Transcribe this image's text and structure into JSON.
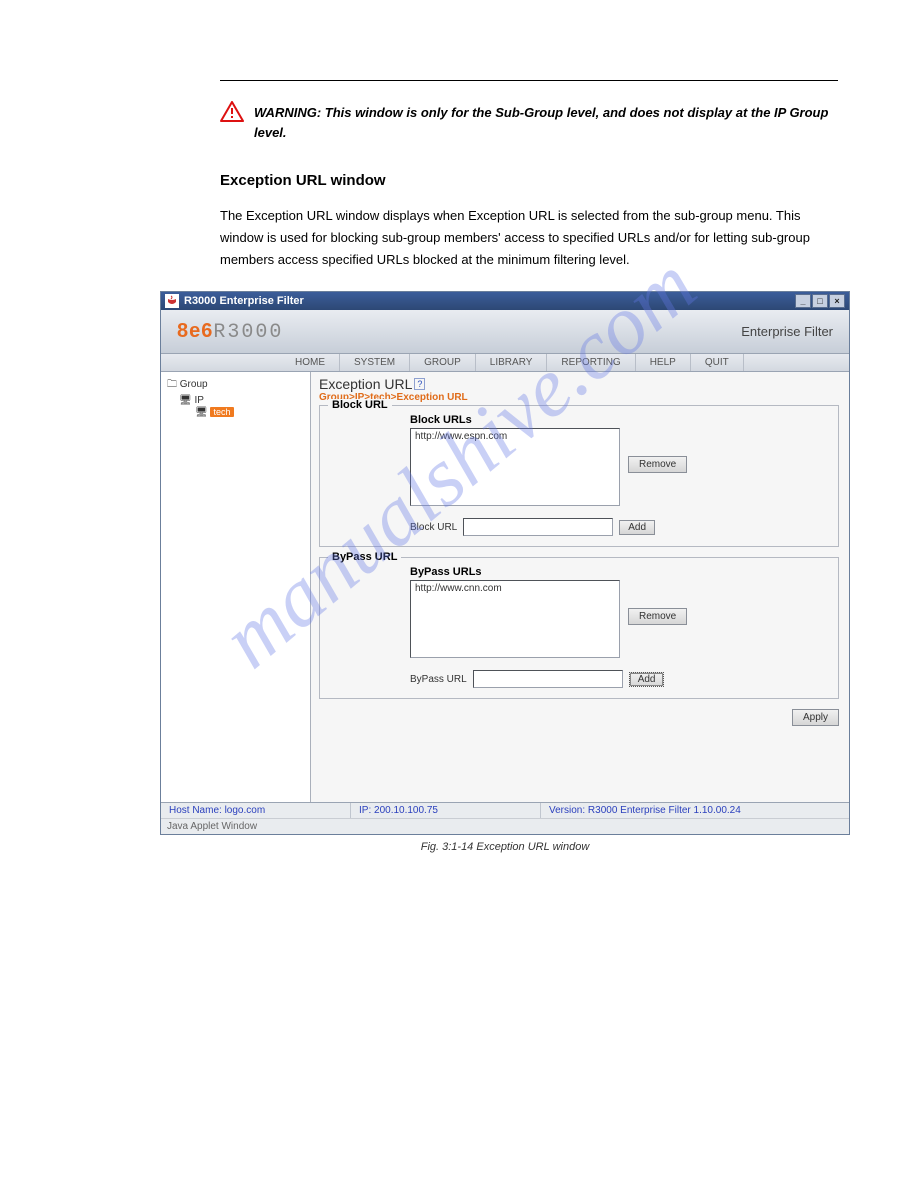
{
  "document": {
    "warning_text": "WARNING: This window is only for the Sub-Group level, and does not display at the IP Group level.",
    "section_title": "Exception URL window",
    "body_text_1": "The Exception URL window displays when Exception URL is selected from the sub-group menu. This window is used for blocking sub-group members' access to specified URLs and/or for letting sub-group members access specified URLs blocked at the minimum filtering level.",
    "figure_caption": "Fig. 3:1-14  Exception URL window"
  },
  "app": {
    "window_title": "R3000 Enterprise Filter",
    "logo_8e6": "8e6",
    "logo_r3000": "R3000",
    "brand_right": "Enterprise Filter",
    "menu": [
      "HOME",
      "SYSTEM",
      "GROUP",
      "LIBRARY",
      "REPORTING",
      "HELP",
      "QUIT"
    ],
    "tree": {
      "root": "Group",
      "ip": "IP",
      "ip_child": "",
      "badge": "tech"
    },
    "content": {
      "title": "Exception URL",
      "help_badge": "?",
      "breadcrumb": "Group>IP>tech>Exception URL",
      "block": {
        "legend": "Block URL",
        "list_label": "Block URLs",
        "items": [
          "http://www.espn.com"
        ],
        "remove": "Remove",
        "input_label": "Block URL",
        "add": "Add"
      },
      "bypass": {
        "legend": "ByPass URL",
        "list_label": "ByPass URLs",
        "items": [
          "http://www.cnn.com"
        ],
        "remove": "Remove",
        "input_label": "ByPass URL",
        "add": "Add"
      },
      "apply": "Apply"
    },
    "statusbar": {
      "host": "Host Name: logo.com",
      "ip": "IP: 200.10.100.75",
      "version": "Version: R3000 Enterprise Filter 1.10.00.24"
    },
    "java_line": "Java Applet Window"
  },
  "watermark": "manualshive.com"
}
